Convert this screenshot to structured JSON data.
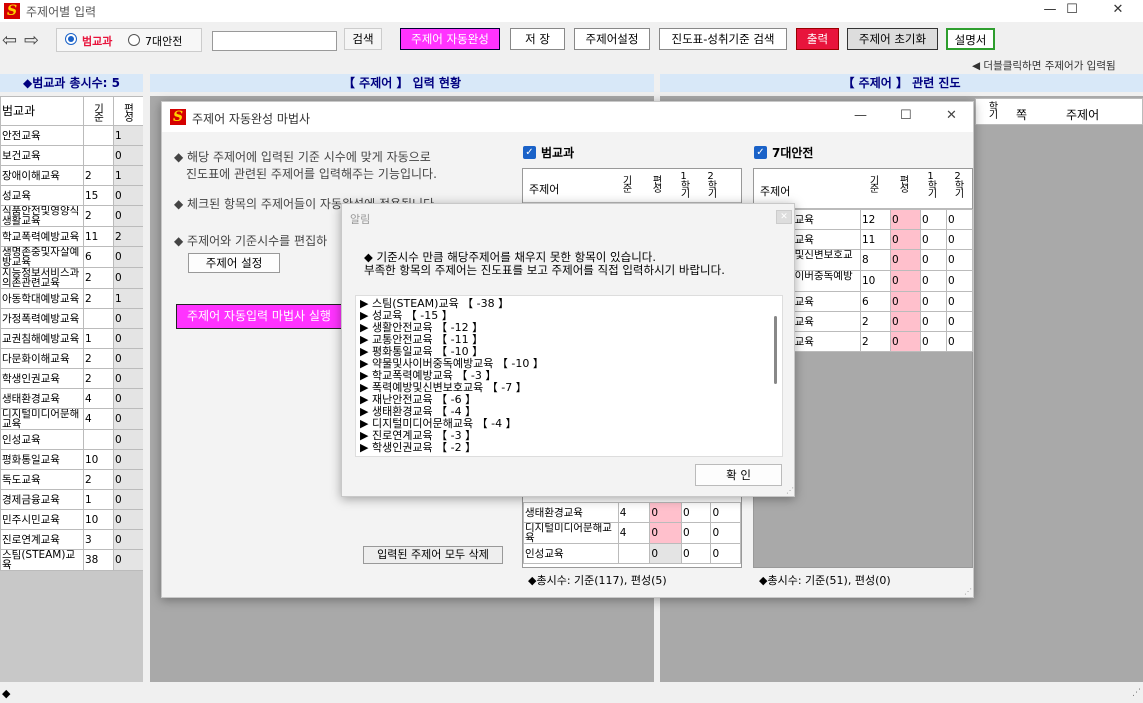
{
  "window": {
    "title": "주제어별 입력",
    "min": "—",
    "max": "☐",
    "close": "✕"
  },
  "toolbar": {
    "radio_a": "범교과",
    "radio_b": "7대안전",
    "search_value": "",
    "search_label": "검색",
    "auto_label": "주제어 자동완성",
    "save_label": "저 장",
    "setting_label": "주제어설정",
    "progress_search_label": "진도표-성취기준 검색",
    "print_label": "출력",
    "reset_label": "주제어 초기화",
    "manual_label": "설명서",
    "hint": "◀ 더블클릭하면 주제어가 입력됨"
  },
  "left": {
    "title": "◆범교과 총시수: 5",
    "headers": [
      "범교과",
      "기준",
      "편성"
    ],
    "rows": [
      {
        "name": "안전교육",
        "base": "",
        "set": "1"
      },
      {
        "name": "보건교육",
        "base": "",
        "set": "0"
      },
      {
        "name": "장애이해교육",
        "base": "2",
        "set": "1"
      },
      {
        "name": "성교육",
        "base": "15",
        "set": "0"
      },
      {
        "name": "식품안전및영양식생활교육",
        "base": "2",
        "set": "0"
      },
      {
        "name": "학교폭력예방교육",
        "base": "11",
        "set": "2"
      },
      {
        "name": "생명존중및자살예방교육",
        "base": "6",
        "set": "0"
      },
      {
        "name": "지능정보서비스과의존관련교육",
        "base": "2",
        "set": "0"
      },
      {
        "name": "아동학대예방교육",
        "base": "2",
        "set": "1"
      },
      {
        "name": "가정폭력예방교육",
        "base": "",
        "set": "0"
      },
      {
        "name": "교권침해예방교육",
        "base": "1",
        "set": "0"
      },
      {
        "name": "다문화이해교육",
        "base": "2",
        "set": "0"
      },
      {
        "name": "학생인권교육",
        "base": "2",
        "set": "0"
      },
      {
        "name": "생태환경교육",
        "base": "4",
        "set": "0"
      },
      {
        "name": "디지털미디어문해교육",
        "base": "4",
        "set": "0"
      },
      {
        "name": "인성교육",
        "base": "",
        "set": "0"
      },
      {
        "name": "평화통일교육",
        "base": "10",
        "set": "0"
      },
      {
        "name": "독도교육",
        "base": "2",
        "set": "0"
      },
      {
        "name": "경제금융교육",
        "base": "1",
        "set": "0"
      },
      {
        "name": "민주시민교육",
        "base": "10",
        "set": "0"
      },
      {
        "name": "진로연계교육",
        "base": "3",
        "set": "0"
      },
      {
        "name": "스팀(STEAM)교육",
        "base": "38",
        "set": "0"
      }
    ]
  },
  "center": {
    "title": "【 주제어 】 입력 현황"
  },
  "right": {
    "title": "【 주제어 】 관련 진도",
    "headers": [
      "학기",
      "쪽",
      "주제어"
    ]
  },
  "wizard": {
    "title": "주제어 자동완성 마법사",
    "desc1": "◆ 해당 주제어에 입력된 기준 시수에 맞게 자동으로",
    "desc2": "진도표에 관련된 주제어를 입력해주는 기능입니다.",
    "desc3": "◆ 체크된 항목의 주제어들이 자동완성에 적용됩니다.",
    "desc4": "◆ 주제어와 기준시수를 편집하",
    "setting_btn": "주제어 설정",
    "run_btn": "주제어 자동입력 마법사 실행",
    "delete_btn": "입력된 주제어 모두 삭제",
    "group_a": "범교과",
    "group_b": "7대안전",
    "table_headers": [
      "주제어",
      "기준",
      "편성",
      "1학기",
      "2학기"
    ],
    "a_rows": [
      {
        "name": "생태환경교육",
        "base": "4",
        "set": "0",
        "s1": "0",
        "s2": "0"
      },
      {
        "name": "디지털미디어문해교육",
        "base": "4",
        "set": "0",
        "s1": "0",
        "s2": "0"
      },
      {
        "name": "인성교육",
        "base": "",
        "set": "0",
        "s1": "0",
        "s2": "0"
      }
    ],
    "b_rows": [
      {
        "name": "생활안전교육",
        "base": "12",
        "set": "0",
        "s1": "0",
        "s2": "0"
      },
      {
        "name": "교통안전교육",
        "base": "11",
        "set": "0",
        "s1": "0",
        "s2": "0"
      },
      {
        "name": "폭력예방및신변보호교육",
        "base": "8",
        "set": "0",
        "s1": "0",
        "s2": "0"
      },
      {
        "name": "약물및사이버중독예방교육",
        "base": "10",
        "set": "0",
        "s1": "0",
        "s2": "0"
      },
      {
        "name": "재난안전교육",
        "base": "6",
        "set": "0",
        "s1": "0",
        "s2": "0"
      },
      {
        "name": "직업안전교육",
        "base": "2",
        "set": "0",
        "s1": "0",
        "s2": "0"
      },
      {
        "name": "응급처치교육",
        "base": "2",
        "set": "0",
        "s1": "0",
        "s2": "0"
      }
    ],
    "total_a": "◆총시수: 기준(117), 편성(5)",
    "total_b": "◆총시수: 기준(51), 편성(0)"
  },
  "alert": {
    "title": "알림",
    "msg1": "◆ 기준시수 만큼 해당주제어를 채우지 못한 항목이 있습니다.",
    "msg2": "부족한 항목의 주제어는 진도표를 보고 주제어를 직접 입력하시기 바랍니다.",
    "items": [
      "▶ 스팀(STEAM)교육 【 -38 】",
      "▶ 성교육 【 -15 】",
      "▶ 생활안전교육 【 -12 】",
      "▶ 교통안전교육 【 -11 】",
      "▶ 평화통일교육 【 -10 】",
      "▶ 약물및사이버중독예방교육 【 -10 】",
      "▶ 학교폭력예방교육 【 -3 】",
      "▶ 폭력예방및신변보호교육 【 -7 】",
      "▶ 재난안전교육 【 -6 】",
      "▶ 생태환경교육 【 -4 】",
      "▶ 디지털미디어문해교육 【 -4 】",
      "▶ 진로연계교육 【 -3 】",
      "▶ 학생인권교육 【 -2 】"
    ],
    "ok": "확 인"
  },
  "status": {
    "marker": "◆"
  },
  "colors": {
    "magenta": "#ff33ff",
    "red": "#e8143c",
    "green_border": "#2e9e2e",
    "pink": "#ffc0cc",
    "header_blue": "#000080"
  }
}
